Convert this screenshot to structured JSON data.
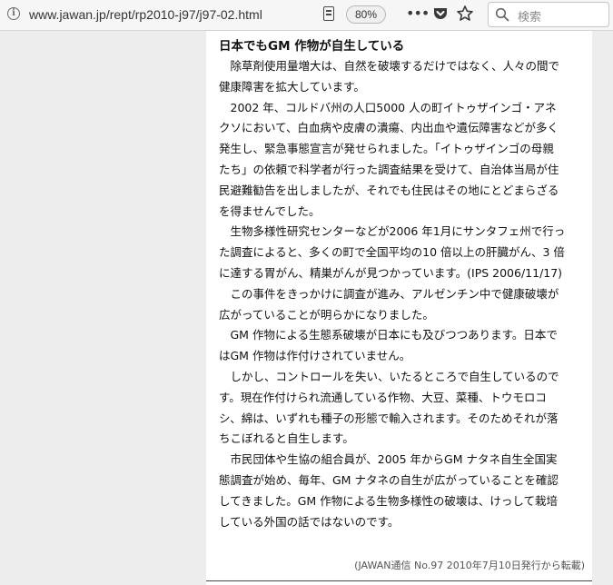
{
  "browser": {
    "url": "www.jawan.jp/rept/rp2010-j97/j97-02.html",
    "zoom": "80%",
    "search_placeholder": "検索"
  },
  "article": {
    "title": "日本でもGM 作物が自生している",
    "lines": [
      "除草剤使用量増大は、自然を破壊するだけではなく、人々の間で",
      "健康障害を拡大しています。",
      "2002 年、コルドバ州の人口5000 人の町イトゥザインゴ・アネ",
      "クソにおいて、白血病や皮膚の潰瘍、内出血や遺伝障害などが多く",
      "発生し、緊急事態宣言が発せられました。「イトゥザインゴの母親",
      "たち」の依頼で科学者が行った調査結果を受けて、自治体当局が住",
      "民避難勧告を出しましたが、それでも住民はその地にとどまらざる",
      "を得ませんでした。",
      "生物多様性研究センターなどが2006 年1月にサンタフェ州で行っ",
      "た調査によると、多くの町で全国平均の10 倍以上の肝臓がん、3 倍",
      "に達する胃がん、精巣がんが見つかっています。(IPS 2006/11/17)",
      "この事件をきっかけに調査が進み、アルゼンチン中で健康破壊が",
      "広がっていることが明らかになりました。",
      "GM 作物による生態系破壊が日本にも及びつつあります。日本で",
      "はGM 作物は作付けされていません。",
      "しかし、コントロールを失い、いたるところで自生しているので",
      "す。現在作付けられ流通している作物、大豆、菜種、トウモロコ",
      "シ、綿は、いずれも種子の形態で輸入されます。そのためそれが落",
      "ちこぼれると自生します。",
      "市民団体や生協の組合員が、2005 年からGM ナタネ自生全国実",
      "態調査が始め、毎年、GM ナタネの自生が広がっていることを確認",
      "してきました。GM 作物による生物多様性の破壊は、けっして栽培",
      "している外国の話ではないのです。"
    ],
    "source": "(JAWAN通信 No.97 2010年7月10日発行から転載)"
  }
}
